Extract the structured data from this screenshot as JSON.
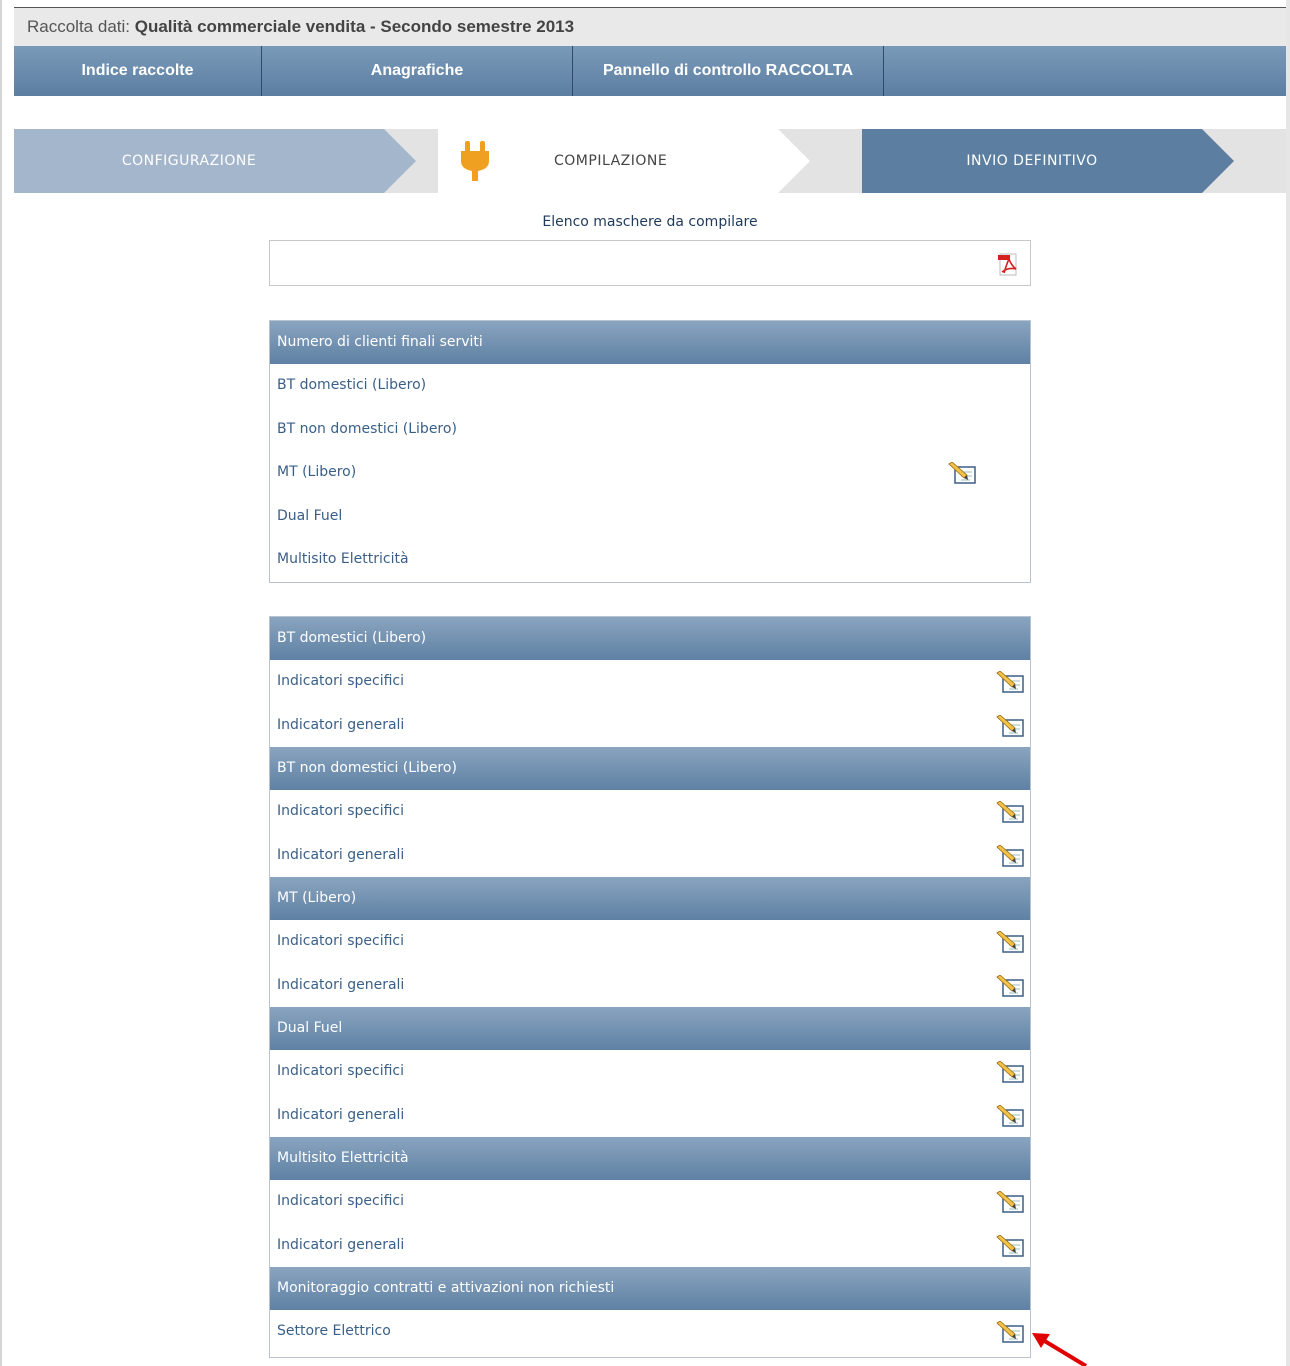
{
  "header": {
    "prefix": "Raccolta dati:",
    "title": "Qualità commerciale vendita - Secondo semestre 2013"
  },
  "nav": {
    "items": [
      "Indice raccolte",
      "Anagrafiche",
      "Pannello di controllo RACCOLTA"
    ]
  },
  "steps": {
    "configurazione": "CONFIGURAZIONE",
    "compilazione": "COMPILAZIONE",
    "invio": "INVIO DEFINITIVO"
  },
  "subtitle": "Elenco maschere da compilare",
  "icons": {
    "pdf": "pdf-icon",
    "edit": "edit-pencil-icon",
    "plug": "plug-icon",
    "pointer": "red-arrow-icon"
  },
  "colors": {
    "nav": "#5b7ea1",
    "step_done": "#a4b6cc",
    "step_active_icon": "#f0a020",
    "pointer": "#e00000"
  },
  "panel1": {
    "header": "Numero di clienti finali serviti",
    "rows": [
      "BT domestici (Libero)",
      "BT non domestici (Libero)",
      "MT (Libero)",
      "Dual Fuel",
      "Multisito Elettricità"
    ]
  },
  "panel2": {
    "sections": [
      {
        "header": "BT domestici (Libero)",
        "rows": [
          "Indicatori specifici",
          "Indicatori generali"
        ]
      },
      {
        "header": "BT non domestici (Libero)",
        "rows": [
          "Indicatori specifici",
          "Indicatori generali"
        ]
      },
      {
        "header": "MT (Libero)",
        "rows": [
          "Indicatori specifici",
          "Indicatori generali"
        ]
      },
      {
        "header": "Dual Fuel",
        "rows": [
          "Indicatori specifici",
          "Indicatori generali"
        ]
      },
      {
        "header": "Multisito Elettricità",
        "rows": [
          "Indicatori specifici",
          "Indicatori generali"
        ]
      },
      {
        "header": "Monitoraggio contratti e attivazioni non richiesti",
        "rows": [
          "Settore Elettrico"
        ]
      }
    ]
  }
}
